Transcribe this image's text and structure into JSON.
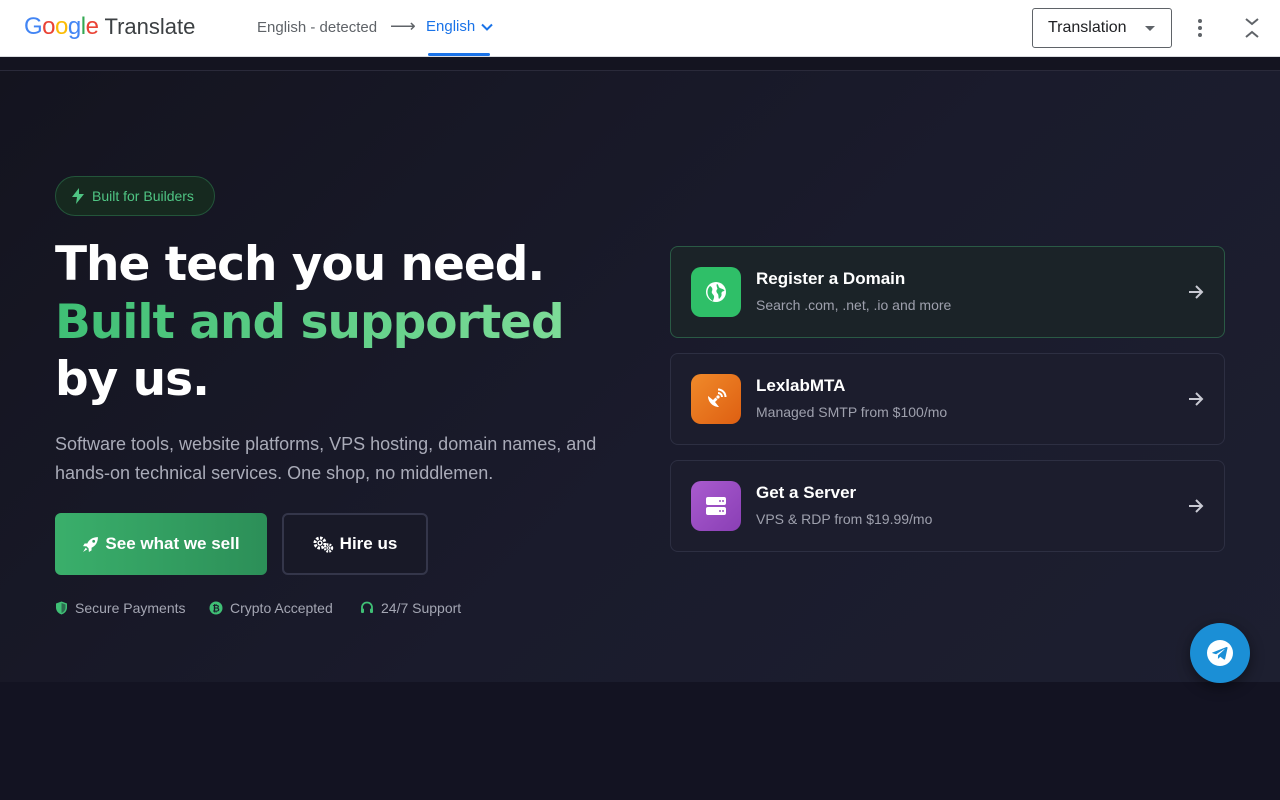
{
  "translate_bar": {
    "logo_letters": [
      {
        "char": "G",
        "color": "#4285F4"
      },
      {
        "char": "o",
        "color": "#EA4335"
      },
      {
        "char": "o",
        "color": "#FBBC05"
      },
      {
        "char": "g",
        "color": "#4285F4"
      },
      {
        "char": "l",
        "color": "#34A853"
      },
      {
        "char": "e",
        "color": "#EA4335"
      }
    ],
    "logo_word": "Translate",
    "source_language": "English - detected",
    "target_language": "English",
    "mode_select": "Translation"
  },
  "hero": {
    "badge": "Built for Builders",
    "headline_line1": "The tech you need.",
    "headline_green": "Built and supported",
    "headline_rest": "by us.",
    "subtitle": "Software tools, website platforms, VPS hosting, domain names, and hands-on technical services. One shop, no middlemen.",
    "primary_button": "See what we sell",
    "secondary_button": "Hire us",
    "trust": [
      {
        "label": "Secure Payments",
        "icon": "shield-icon"
      },
      {
        "label": "Crypto Accepted",
        "icon": "bitcoin-icon"
      },
      {
        "label": "24/7 Support",
        "icon": "headset-icon"
      }
    ]
  },
  "cards": [
    {
      "title": "Register a Domain",
      "desc": "Search .com, .net, .io and more",
      "icon": "globe-icon",
      "color": "#2fbf68"
    },
    {
      "title": "LexlabMTA",
      "desc": "Managed SMTP from $100/mo",
      "icon": "satellite-dish-icon",
      "color": "#e8731c"
    },
    {
      "title": "Get a Server",
      "desc": "VPS & RDP from $19.99/mo",
      "icon": "server-icon",
      "color": "#9a4fc0"
    }
  ],
  "colors": {
    "accent_green": "#3fbf75",
    "telegram_blue": "#1b8fd6",
    "google_blue": "#1a73e8"
  }
}
